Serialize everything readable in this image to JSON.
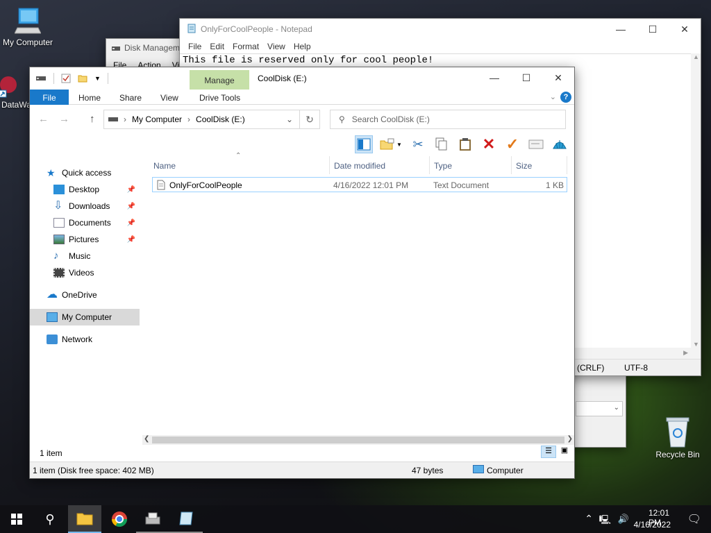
{
  "desktop": {
    "icons": [
      {
        "label": "My Computer"
      },
      {
        "label": "DataWa"
      },
      {
        "label": "Recycle Bin"
      }
    ]
  },
  "notepad": {
    "title": "OnlyForCoolPeople - Notepad",
    "menu": [
      "File",
      "Edit",
      "Format",
      "View",
      "Help"
    ],
    "content": "This file is reserved only for cool people!",
    "status": {
      "eol": "(CRLF)",
      "encoding": "UTF-8"
    }
  },
  "diskmgmt": {
    "title": "Disk Managem",
    "menu": [
      "File",
      "Action",
      "Vi"
    ]
  },
  "explorer": {
    "title": "CoolDisk (E:)",
    "context_tab": "Manage",
    "tabs": [
      "File",
      "Home",
      "Share",
      "View",
      "Drive Tools"
    ],
    "breadcrumb": [
      "My Computer",
      "CoolDisk (E:)"
    ],
    "search_placeholder": "Search CoolDisk (E:)",
    "columns": [
      "Name",
      "Date modified",
      "Type",
      "Size"
    ],
    "files": [
      {
        "name": "OnlyForCoolPeople",
        "modified": "4/16/2022 12:01 PM",
        "type": "Text Document",
        "size": "1 KB"
      }
    ],
    "nav": {
      "quick_access": "Quick access",
      "pinned": [
        "Desktop",
        "Downloads",
        "Documents",
        "Pictures"
      ],
      "recent": [
        "Music",
        "Videos"
      ],
      "onedrive": "OneDrive",
      "my_computer": "My Computer",
      "network": "Network"
    },
    "item_count": "1 item",
    "status": {
      "left": "1 item (Disk free space: 402 MB)",
      "size": "47 bytes",
      "zone": "Computer"
    }
  },
  "taskbar": {
    "clock_time": "12:01 PM",
    "clock_date": "4/16/2022"
  },
  "colors": {
    "accent": "#1979ca",
    "manage_tab": "#c6e0a8",
    "selection": "#d9d9d9"
  }
}
